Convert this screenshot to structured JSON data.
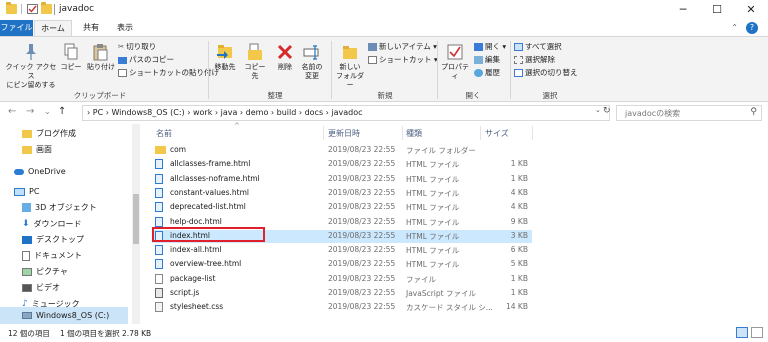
{
  "window": {
    "title": "javadoc",
    "controls": [
      "─",
      "☐",
      "✕"
    ]
  },
  "ribbon_tabs": {
    "file": "ファイル",
    "home": "ホーム",
    "share": "共有",
    "view": "表示",
    "toggle": "⌃",
    "help": "?"
  },
  "ribbon": {
    "clipboard": {
      "pin_line1": "クイック アクセス",
      "pin_line2": "にピン留めする",
      "copy": "コピー",
      "paste": "貼り付け",
      "cut": "切り取り",
      "copy_path": "パスのコピー",
      "paste_shortcut": "ショートカットの貼り付け",
      "label": "クリップボード"
    },
    "organize": {
      "move_to": "移動先",
      "copy_to": "コピー先",
      "delete": "削除",
      "rename_line1": "名前の",
      "rename_line2": "変更",
      "label": "整理"
    },
    "new": {
      "new_folder_line1": "新しい",
      "new_folder_line2": "フォルダー",
      "new_item": "新しいアイテム",
      "shortcut": "ショートカット",
      "label": "新規"
    },
    "open": {
      "properties": "プロパティ",
      "open": "開く",
      "edit": "編集",
      "history": "履歴",
      "label": "開く"
    },
    "select": {
      "select_all": "すべて選択",
      "select_none": "選択解除",
      "invert": "選択の切り替え",
      "label": "選択"
    }
  },
  "address": {
    "back": "←",
    "forward": "→",
    "recent": "⌄",
    "up": "↑",
    "path": "›  PC  ›  Windows8_OS (C:)  ›  work  ›  java  ›  demo  ›  build  ›  docs  ›  javadoc",
    "dropdown": "⌄",
    "refresh": "↻",
    "search_placeholder": "javadocの検索",
    "search_icon": "⚲"
  },
  "nav_pane": {
    "items": [
      {
        "label": "ブログ作成",
        "icon": "folder-icon"
      },
      {
        "label": "画面",
        "icon": "folder-icon"
      },
      {
        "label": "OneDrive",
        "icon": "cloud-icon"
      },
      {
        "label": "PC",
        "icon": "pc-icon"
      },
      {
        "label": "3D オブジェクト",
        "icon": "cube-icon"
      },
      {
        "label": "ダウンロード",
        "icon": "download-icon"
      },
      {
        "label": "デスクトップ",
        "icon": "desktop-icon"
      },
      {
        "label": "ドキュメント",
        "icon": "document-icon"
      },
      {
        "label": "ピクチャ",
        "icon": "picture-icon"
      },
      {
        "label": "ビデオ",
        "icon": "video-icon"
      },
      {
        "label": "ミュージック",
        "icon": "music-icon"
      },
      {
        "label": "Windows8_OS (C:)",
        "icon": "drive-icon"
      }
    ]
  },
  "file_list": {
    "columns": {
      "name": "名前",
      "date": "更新日時",
      "type": "種類",
      "size": "サイズ"
    },
    "sort_indicator": "^",
    "rows": [
      {
        "name": "com",
        "date": "2019/08/23 22:55",
        "type": "ファイル フォルダー",
        "size": "",
        "icon": "folder-icon"
      },
      {
        "name": "allclasses-frame.html",
        "date": "2019/08/23 22:55",
        "type": "HTML ファイル",
        "size": "1 KB",
        "icon": "html-file-icon"
      },
      {
        "name": "allclasses-noframe.html",
        "date": "2019/08/23 22:55",
        "type": "HTML ファイル",
        "size": "1 KB",
        "icon": "html-file-icon"
      },
      {
        "name": "constant-values.html",
        "date": "2019/08/23 22:55",
        "type": "HTML ファイル",
        "size": "4 KB",
        "icon": "html-file-icon"
      },
      {
        "name": "deprecated-list.html",
        "date": "2019/08/23 22:55",
        "type": "HTML ファイル",
        "size": "4 KB",
        "icon": "html-file-icon"
      },
      {
        "name": "help-doc.html",
        "date": "2019/08/23 22:55",
        "type": "HTML ファイル",
        "size": "9 KB",
        "icon": "html-file-icon"
      },
      {
        "name": "index.html",
        "date": "2019/08/23 22:55",
        "type": "HTML ファイル",
        "size": "3 KB",
        "icon": "html-file-icon"
      },
      {
        "name": "index-all.html",
        "date": "2019/08/23 22:55",
        "type": "HTML ファイル",
        "size": "6 KB",
        "icon": "html-file-icon"
      },
      {
        "name": "overview-tree.html",
        "date": "2019/08/23 22:55",
        "type": "HTML ファイル",
        "size": "5 KB",
        "icon": "html-file-icon"
      },
      {
        "name": "package-list",
        "date": "2019/08/23 22:55",
        "type": "ファイル",
        "size": "1 KB",
        "icon": "blank-file-icon"
      },
      {
        "name": "script.js",
        "date": "2019/08/23 22:55",
        "type": "JavaScript ファイル",
        "size": "1 KB",
        "icon": "script-file-icon"
      },
      {
        "name": "stylesheet.css",
        "date": "2019/08/23 22:55",
        "type": "カスケード スタイル シ...",
        "size": "14 KB",
        "icon": "css-file-icon"
      }
    ]
  },
  "status": {
    "items": "12 個の項目",
    "selected": "1 個の項目を選択  2.78 KB"
  },
  "colors": {
    "accent": "#1f72c4",
    "selection": "#cce8ff",
    "highlight_box": "#e0202d",
    "folder": "#f2c84b"
  }
}
